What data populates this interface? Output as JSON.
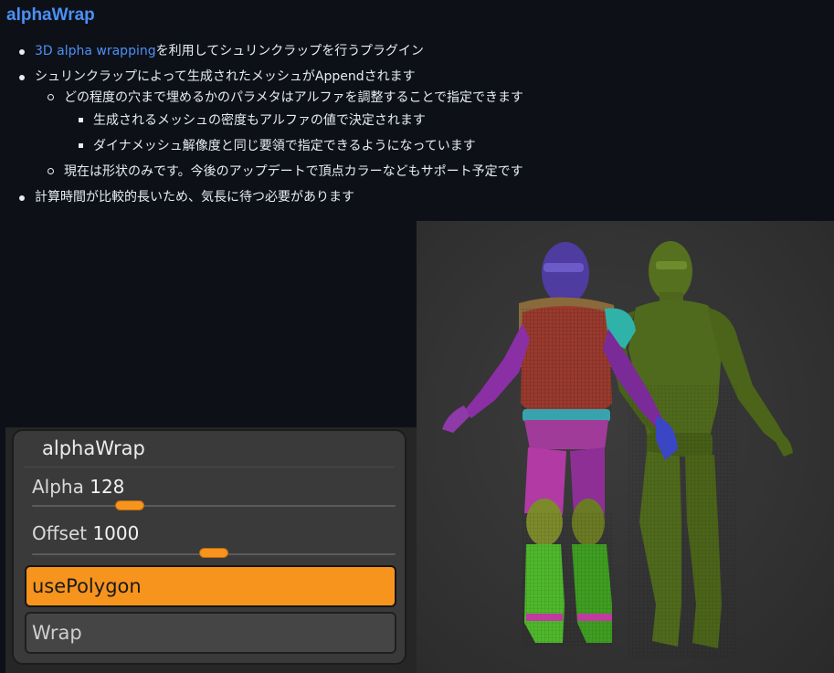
{
  "heading": "alphaWrap",
  "bullets": [
    {
      "link": "3D alpha wrapping",
      "text": "を利用してシュリンクラップを行うプラグイン"
    },
    {
      "text": "シュリンクラップによって生成されたメッシュがAppendされます"
    },
    {
      "text": "どの程度の穴まで埋めるかのパラメタはアルファを調整することで指定できます"
    },
    {
      "text": "生成されるメッシュの密度もアルファの値で決定されます"
    },
    {
      "text": "ダイナメッシュ解像度と同じ要領で指定できるようになっています"
    },
    {
      "text": "現在は形状のみです。今後のアップデートで頂点カラーなどもサポート予定です"
    },
    {
      "text": "計算時間が比較的長いため、気長に待つ必要があります"
    }
  ],
  "panel": {
    "title": "alphaWrap",
    "alpha_label": "Alpha",
    "alpha_value": "128",
    "alpha_level": 0.27,
    "offset_label": "Offset",
    "offset_value": "1000",
    "offset_level": 0.5,
    "use_polygon_label": "usePolygon",
    "wrap_label": "Wrap"
  },
  "colors": {
    "link": "#4c8ff7",
    "accent": "#f7941d",
    "page_background": "#0d1117",
    "mesh_green": "#4f6a1c"
  }
}
